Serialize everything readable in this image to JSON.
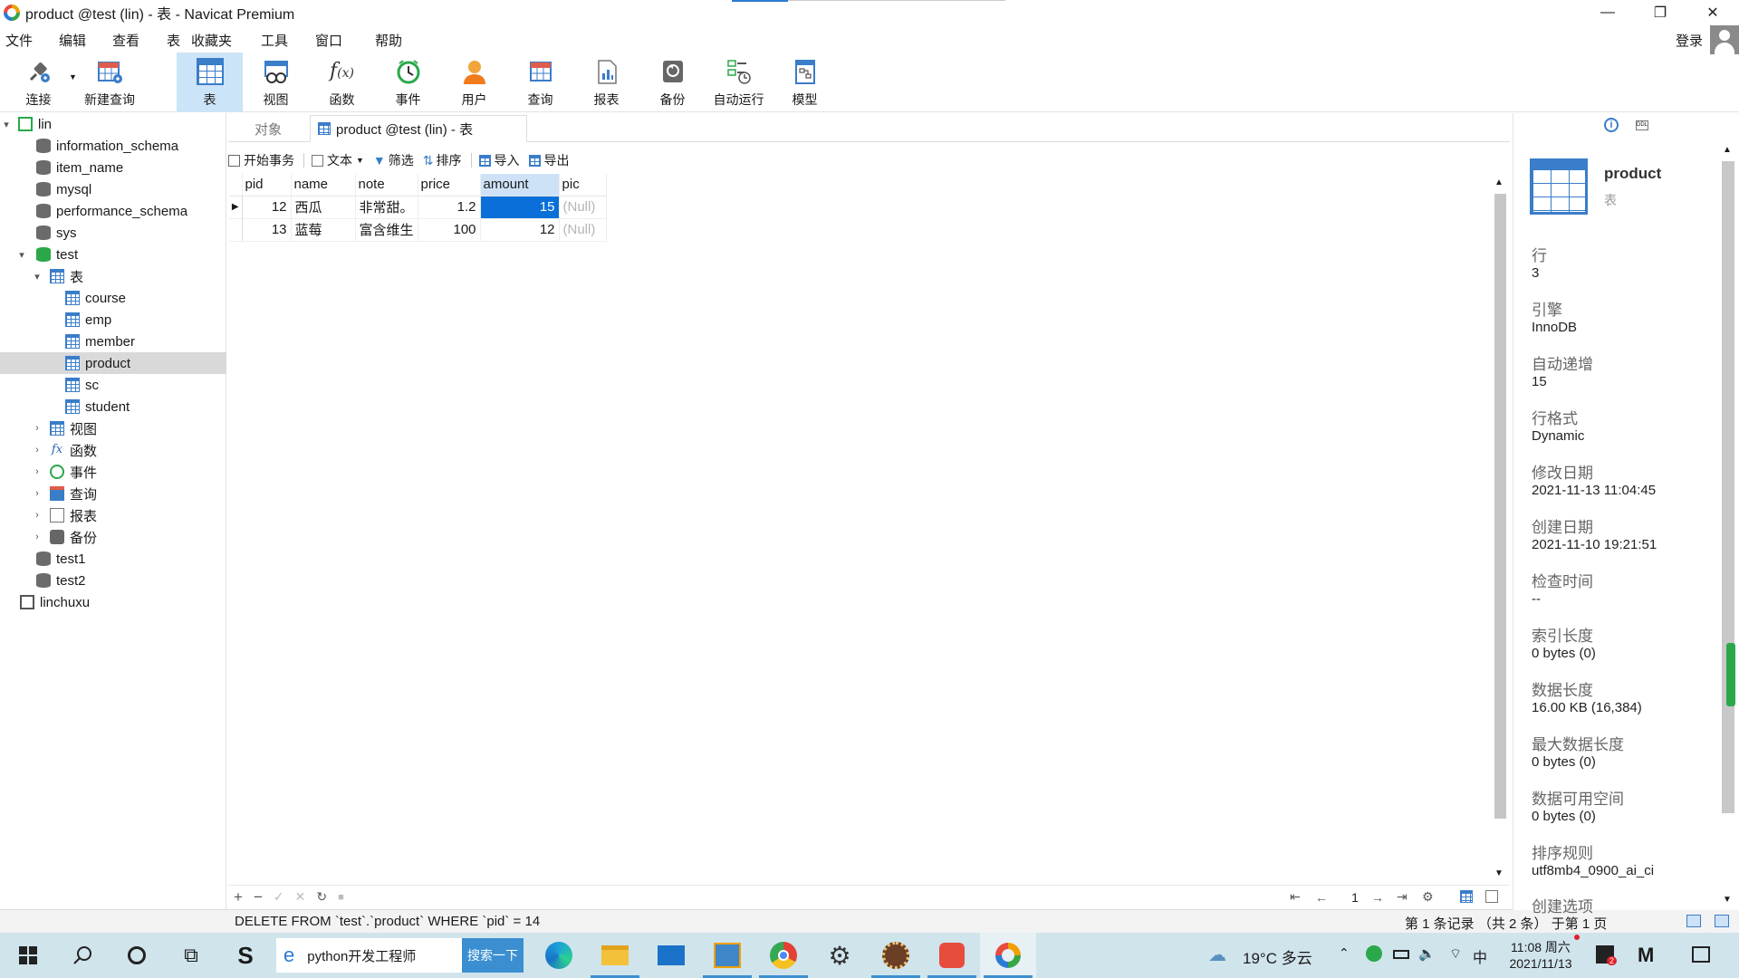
{
  "window": {
    "title": "product @test (lin) - 表 - Navicat Premium",
    "controls": {
      "minimize": "—",
      "restore": "❐",
      "close": "✕"
    }
  },
  "menu": [
    "文件",
    "编辑",
    "查看",
    "表",
    "收藏夹",
    "工具",
    "窗口",
    "帮助"
  ],
  "login_label": "登录",
  "toolbar": [
    {
      "label": "连接",
      "icon": "plug-icon"
    },
    {
      "label": "新建查询",
      "icon": "new-query-icon"
    },
    {
      "label": "表",
      "icon": "table-icon",
      "active": true
    },
    {
      "label": "视图",
      "icon": "view-icon"
    },
    {
      "label": "函数",
      "icon": "function-icon"
    },
    {
      "label": "事件",
      "icon": "event-clock-icon"
    },
    {
      "label": "用户",
      "icon": "user-icon"
    },
    {
      "label": "查询",
      "icon": "query-icon"
    },
    {
      "label": "报表",
      "icon": "report-icon"
    },
    {
      "label": "备份",
      "icon": "backup-icon"
    },
    {
      "label": "自动运行",
      "icon": "automation-icon"
    },
    {
      "label": "模型",
      "icon": "model-icon"
    }
  ],
  "tree": [
    {
      "label": "lin",
      "kind": "connection",
      "expanded": true
    },
    {
      "label": "information_schema",
      "kind": "db"
    },
    {
      "label": "item_name",
      "kind": "db"
    },
    {
      "label": "mysql",
      "kind": "db"
    },
    {
      "label": "performance_schema",
      "kind": "db"
    },
    {
      "label": "sys",
      "kind": "db"
    },
    {
      "label": "test",
      "kind": "db-open",
      "expanded": true
    },
    {
      "label": "表",
      "kind": "folder-tables",
      "expanded": true
    },
    {
      "label": "course",
      "kind": "table"
    },
    {
      "label": "emp",
      "kind": "table"
    },
    {
      "label": "member",
      "kind": "table"
    },
    {
      "label": "product",
      "kind": "table",
      "selected": true
    },
    {
      "label": "sc",
      "kind": "table"
    },
    {
      "label": "student",
      "kind": "table"
    },
    {
      "label": "视图",
      "kind": "folder-views"
    },
    {
      "label": "函数",
      "kind": "folder-functions"
    },
    {
      "label": "事件",
      "kind": "folder-events"
    },
    {
      "label": "查询",
      "kind": "folder-queries"
    },
    {
      "label": "报表",
      "kind": "folder-reports"
    },
    {
      "label": "备份",
      "kind": "folder-backups"
    },
    {
      "label": "test1",
      "kind": "db"
    },
    {
      "label": "test2",
      "kind": "db"
    },
    {
      "label": "linchuxu",
      "kind": "connection"
    }
  ],
  "tabs": {
    "objects": "对象",
    "active": "product @test (lin) - 表"
  },
  "subtoolbar": {
    "begin_tx": "开始事务",
    "text": "文本",
    "filter": "筛选",
    "sort": "排序",
    "import": "导入",
    "export": "导出"
  },
  "table": {
    "columns": [
      "pid",
      "name",
      "note",
      "price",
      "amount",
      "pic"
    ],
    "rows": [
      [
        "12",
        "西瓜",
        "非常甜。",
        "1.2",
        "15",
        "(Null)"
      ],
      [
        "13",
        "蓝莓",
        "富含维生",
        "100",
        "12",
        "(Null)"
      ]
    ]
  },
  "bottombar": {
    "add": "+",
    "remove": "−",
    "apply": "✓",
    "discard": "✕",
    "refresh": "↻",
    "stop": "■",
    "page": "1"
  },
  "status": {
    "sql": "DELETE FROM `test`.`product` WHERE `pid` = 14",
    "records": "第 1 条记录 （共 2 条） 于第 1 页"
  },
  "info": {
    "name": "product",
    "type": "表",
    "fields": [
      {
        "label": "行",
        "value": "3"
      },
      {
        "label": "引擎",
        "value": "InnoDB"
      },
      {
        "label": "自动递增",
        "value": "15"
      },
      {
        "label": "行格式",
        "value": "Dynamic"
      },
      {
        "label": "修改日期",
        "value": "2021-11-13 11:04:45"
      },
      {
        "label": "创建日期",
        "value": "2021-11-10 19:21:51"
      },
      {
        "label": "检查时间",
        "value": "--"
      },
      {
        "label": "索引长度",
        "value": "0 bytes (0)"
      },
      {
        "label": "数据长度",
        "value": "16.00 KB (16,384)"
      },
      {
        "label": "最大数据长度",
        "value": "0 bytes (0)"
      },
      {
        "label": "数据可用空间",
        "value": "0 bytes (0)"
      },
      {
        "label": "排序规则",
        "value": "utf8mb4_0900_ai_ci"
      },
      {
        "label": "创建选项",
        "value": ""
      }
    ]
  },
  "taskbar": {
    "browser_tab": "python开发工程师",
    "search_btn": "搜索一下",
    "weather": "19°C 多云",
    "ime": "中",
    "time": "11:08 周六",
    "date": "2021/11/13",
    "notif_count": "2"
  }
}
